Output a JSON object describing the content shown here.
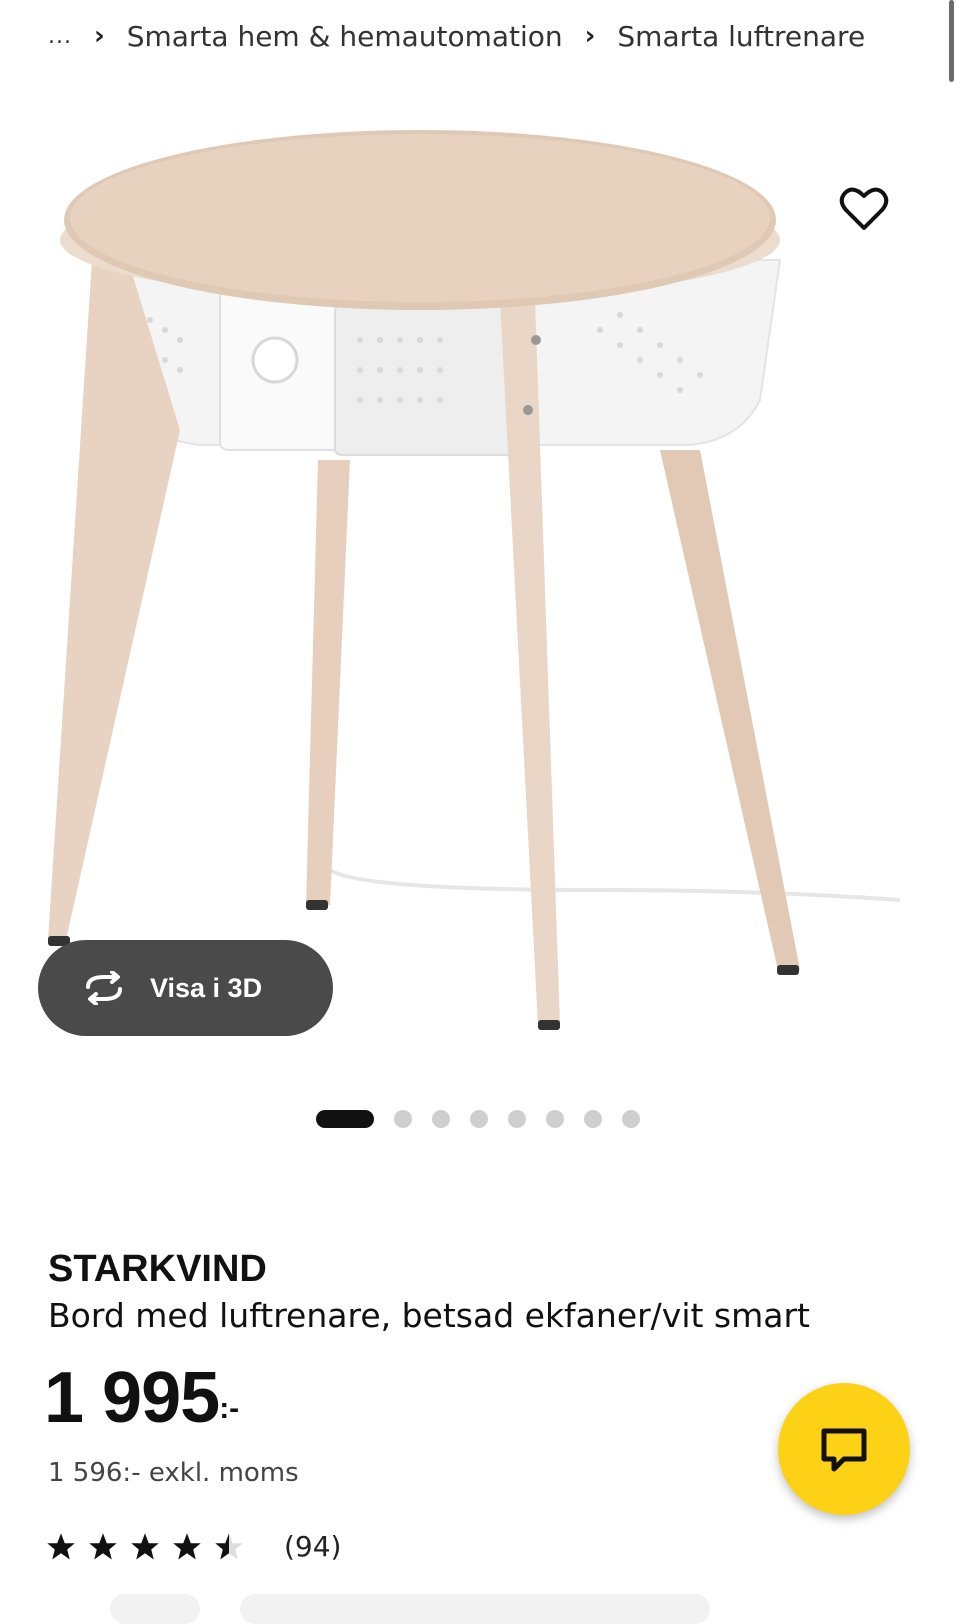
{
  "breadcrumb": {
    "ellipsis": "...",
    "items": [
      "Smarta hem & hemautomation",
      "Smarta luftrenare"
    ]
  },
  "gallery": {
    "view_3d_label": "Visa i 3D",
    "total_images": 8,
    "active_index": 0
  },
  "product": {
    "name": "STARKVIND",
    "description": "Bord med luftrenare, betsad ekfaner/vit smart",
    "price": "1 995",
    "price_suffix": ":-",
    "price_ex_vat": "1 596:- exkl. moms",
    "rating_value": 4.5,
    "review_count": "(94)"
  },
  "colors": {
    "chat_button": "#fcd116",
    "view3d_button": "#4a4a4a",
    "active_dot": "#111111",
    "inactive_dot": "#cfcfcf"
  },
  "icons": {
    "favorite": "heart-outline-icon",
    "view3d": "rotate-3d-icon",
    "chat": "chat-bubble-icon",
    "star": "star-icon"
  }
}
